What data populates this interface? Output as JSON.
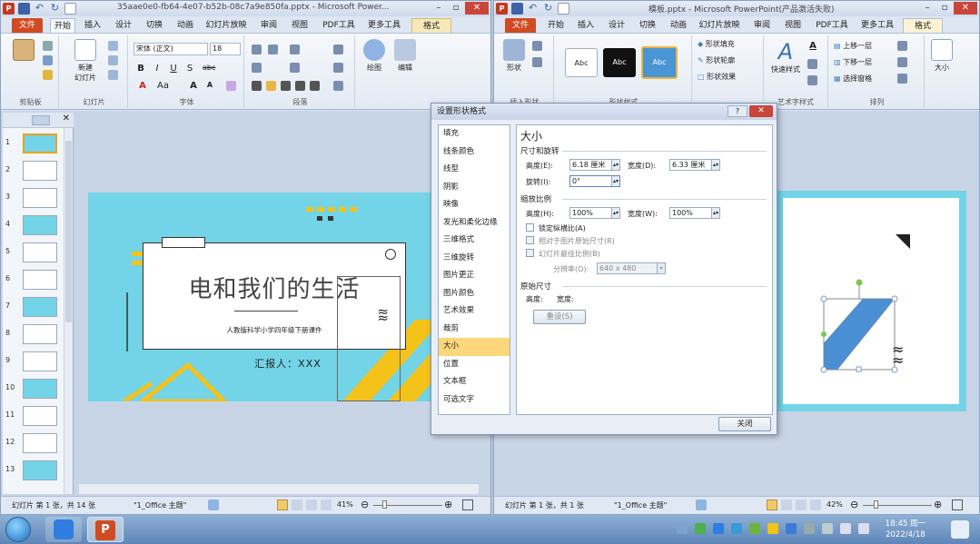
{
  "left_window": {
    "title": "35aae0e0-fb64-4e07-b52b-08c7a9e850fa.pptx - Microsoft Power...",
    "tabs": [
      "文件",
      "开始",
      "插入",
      "设计",
      "切换",
      "动画",
      "幻灯片放映",
      "审阅",
      "视图",
      "PDF工具",
      "更多工具",
      "格式"
    ],
    "active_tab": "开始",
    "ribbon": {
      "groups": [
        "剪贴板",
        "幻灯片",
        "字体",
        "段落"
      ],
      "paste_label": "粘贴",
      "new_slide_label": "新建\n幻灯片",
      "font_name": "宋体 (正文)",
      "font_size": "18",
      "drawing_label": "绘图",
      "editing_label": "编辑"
    },
    "slide": {
      "title": "电和我们的生活",
      "subtitle": "人教版科学小学四年级下册课件",
      "reporter": "汇报人：XXX"
    },
    "thumbnail_numbers": [
      "1",
      "2",
      "3",
      "4",
      "5",
      "6",
      "7",
      "8",
      "9",
      "10",
      "11",
      "12",
      "13"
    ],
    "status": {
      "slide_info": "幻灯片 第 1 张，共 14 张",
      "theme": "\"1_Office 主题\"",
      "zoom": "41%"
    }
  },
  "right_window": {
    "title": "模板.pptx - Microsoft PowerPoint(产品激活失败)",
    "tabs": [
      "文件",
      "开始",
      "插入",
      "设计",
      "切换",
      "动画",
      "幻灯片放映",
      "审阅",
      "视图",
      "PDF工具",
      "更多工具",
      "格式"
    ],
    "active_tab": "格式",
    "ribbon": {
      "shape_label": "形状",
      "style_sample": "Abc",
      "shape_fill": "形状填充",
      "shape_outline": "形状轮廓",
      "shape_effects": "形状效果",
      "quick_styles": "快速样式",
      "bring_forward": "上移一层",
      "send_backward": "下移一层",
      "selection_pane": "选择窗格",
      "size_label": "大小",
      "groups": [
        "插入形状",
        "形状样式",
        "艺术字样式",
        "排列"
      ]
    },
    "status": {
      "slide_info": "幻灯片 第 1 张，共 1 张",
      "theme": "\"1_Office 主题\"",
      "zoom": "42%"
    }
  },
  "dialog": {
    "title": "设置形状格式",
    "close_label": "关闭",
    "categories": [
      "填充",
      "线条颜色",
      "线型",
      "阴影",
      "映像",
      "发光和柔化边缘",
      "三维格式",
      "三维旋转",
      "图片更正",
      "图片颜色",
      "艺术效果",
      "裁剪",
      "大小",
      "位置",
      "文本框",
      "可选文字"
    ],
    "selected_category": "大小",
    "pane_title": "大小",
    "size_rotate_section": "尺寸和旋转",
    "height_label": "高度(E):",
    "height_value": "6.18 厘米",
    "width_label": "宽度(D):",
    "width_value": "6.33 厘米",
    "rotation_label": "旋转(I):",
    "rotation_value": "0°",
    "scale_section": "缩放比例",
    "scale_height_label": "高度(H):",
    "scale_height_value": "100%",
    "scale_width_label": "宽度(W):",
    "scale_width_value": "100%",
    "lock_aspect": "锁定纵横比(A)",
    "relative_original": "相对于图片原始尺寸(R)",
    "best_scale": "幻灯片最佳比例(B)",
    "resolution_label": "分辨率(O):",
    "resolution_value": "640 x 480",
    "original_section": "原始尺寸",
    "orig_height": "高度:",
    "orig_width": "宽度:",
    "reset_label": "重设(S)"
  },
  "taskbar": {
    "time": "18:45 周一",
    "date": "2022/4/18"
  },
  "colors": {
    "slide_bg": "#72d4e6",
    "accent_yellow": "#f5c21a",
    "ppt_orange": "#d04b22",
    "selection": "#fbd67a"
  }
}
